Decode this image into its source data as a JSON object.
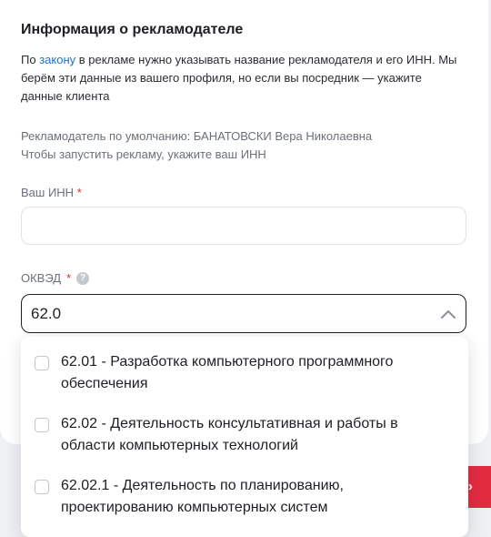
{
  "section": {
    "title": "Информация о рекламодателе",
    "desc_prefix": "По ",
    "desc_link": "закону",
    "desc_rest": " в рекламе нужно указывать название рекламодателя и его ИНН. Мы берём эти данные из вашего профиля, но если вы посредник — укажите данные клиента",
    "info_line1": "Рекламодатель по умолчанию: БАНАТОВСКИ Вера Николаевна",
    "info_line2": "Чтобы запустить рекламу, укажите ваш ИНН"
  },
  "inn": {
    "label": "Ваш ИНН",
    "required_mark": "*",
    "value": ""
  },
  "okved": {
    "label": "ОКВЭД",
    "required_mark": "*",
    "help_icon": "?",
    "value": "62.0",
    "options": [
      {
        "label": "62.01 - Разработка компьютерного программного обеспечения",
        "checked": false
      },
      {
        "label": "62.02 - Деятельность консультативная и работы в области компьютерных технологий",
        "checked": false
      },
      {
        "label": "62.02.1 - Деятельность по планированию, проектированию компьютерных систем",
        "checked": false
      }
    ]
  },
  "colors": {
    "accent_link": "#1a73d9",
    "required": "#e0283b",
    "button": "#e32b40"
  },
  "icons": {
    "help": "question-circle-icon",
    "chevron": "chevron-up-icon"
  }
}
